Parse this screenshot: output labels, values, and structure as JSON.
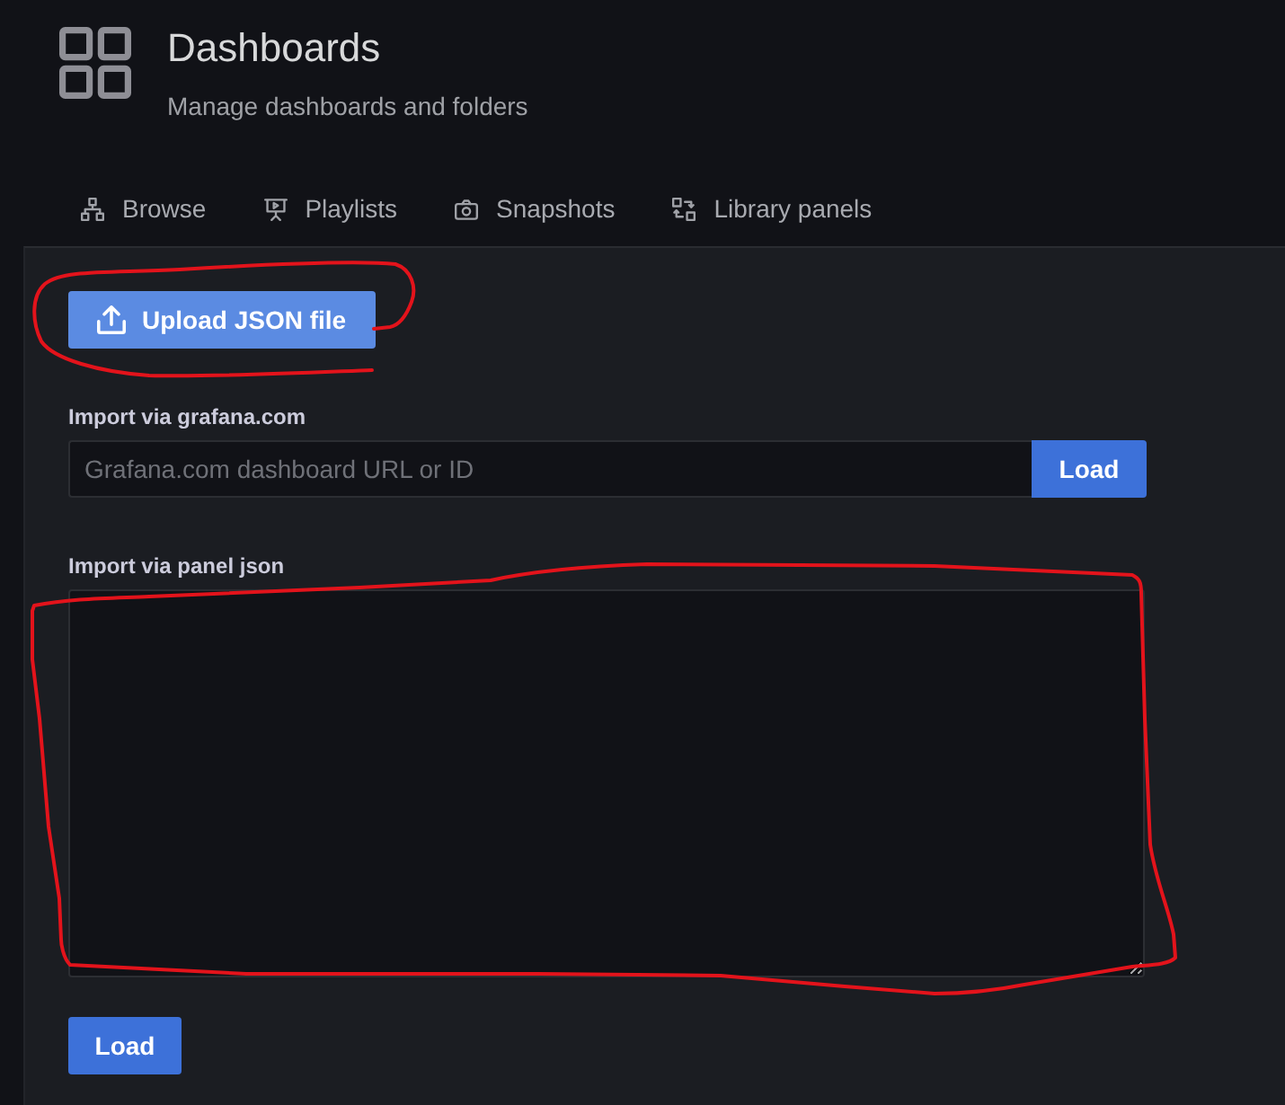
{
  "header": {
    "title": "Dashboards",
    "subtitle": "Manage dashboards and folders"
  },
  "tabs": [
    {
      "label": "Browse",
      "selected": false
    },
    {
      "label": "Playlists",
      "selected": false
    },
    {
      "label": "Snapshots",
      "selected": false
    },
    {
      "label": "Library panels",
      "selected": false
    }
  ],
  "upload_button": {
    "label": "Upload JSON file"
  },
  "import_via_grafana": {
    "label": "Import via grafana.com",
    "placeholder": "Grafana.com dashboard URL or ID",
    "button": "Load"
  },
  "import_via_panel_json": {
    "label": "Import via panel json",
    "button": "Load"
  }
}
